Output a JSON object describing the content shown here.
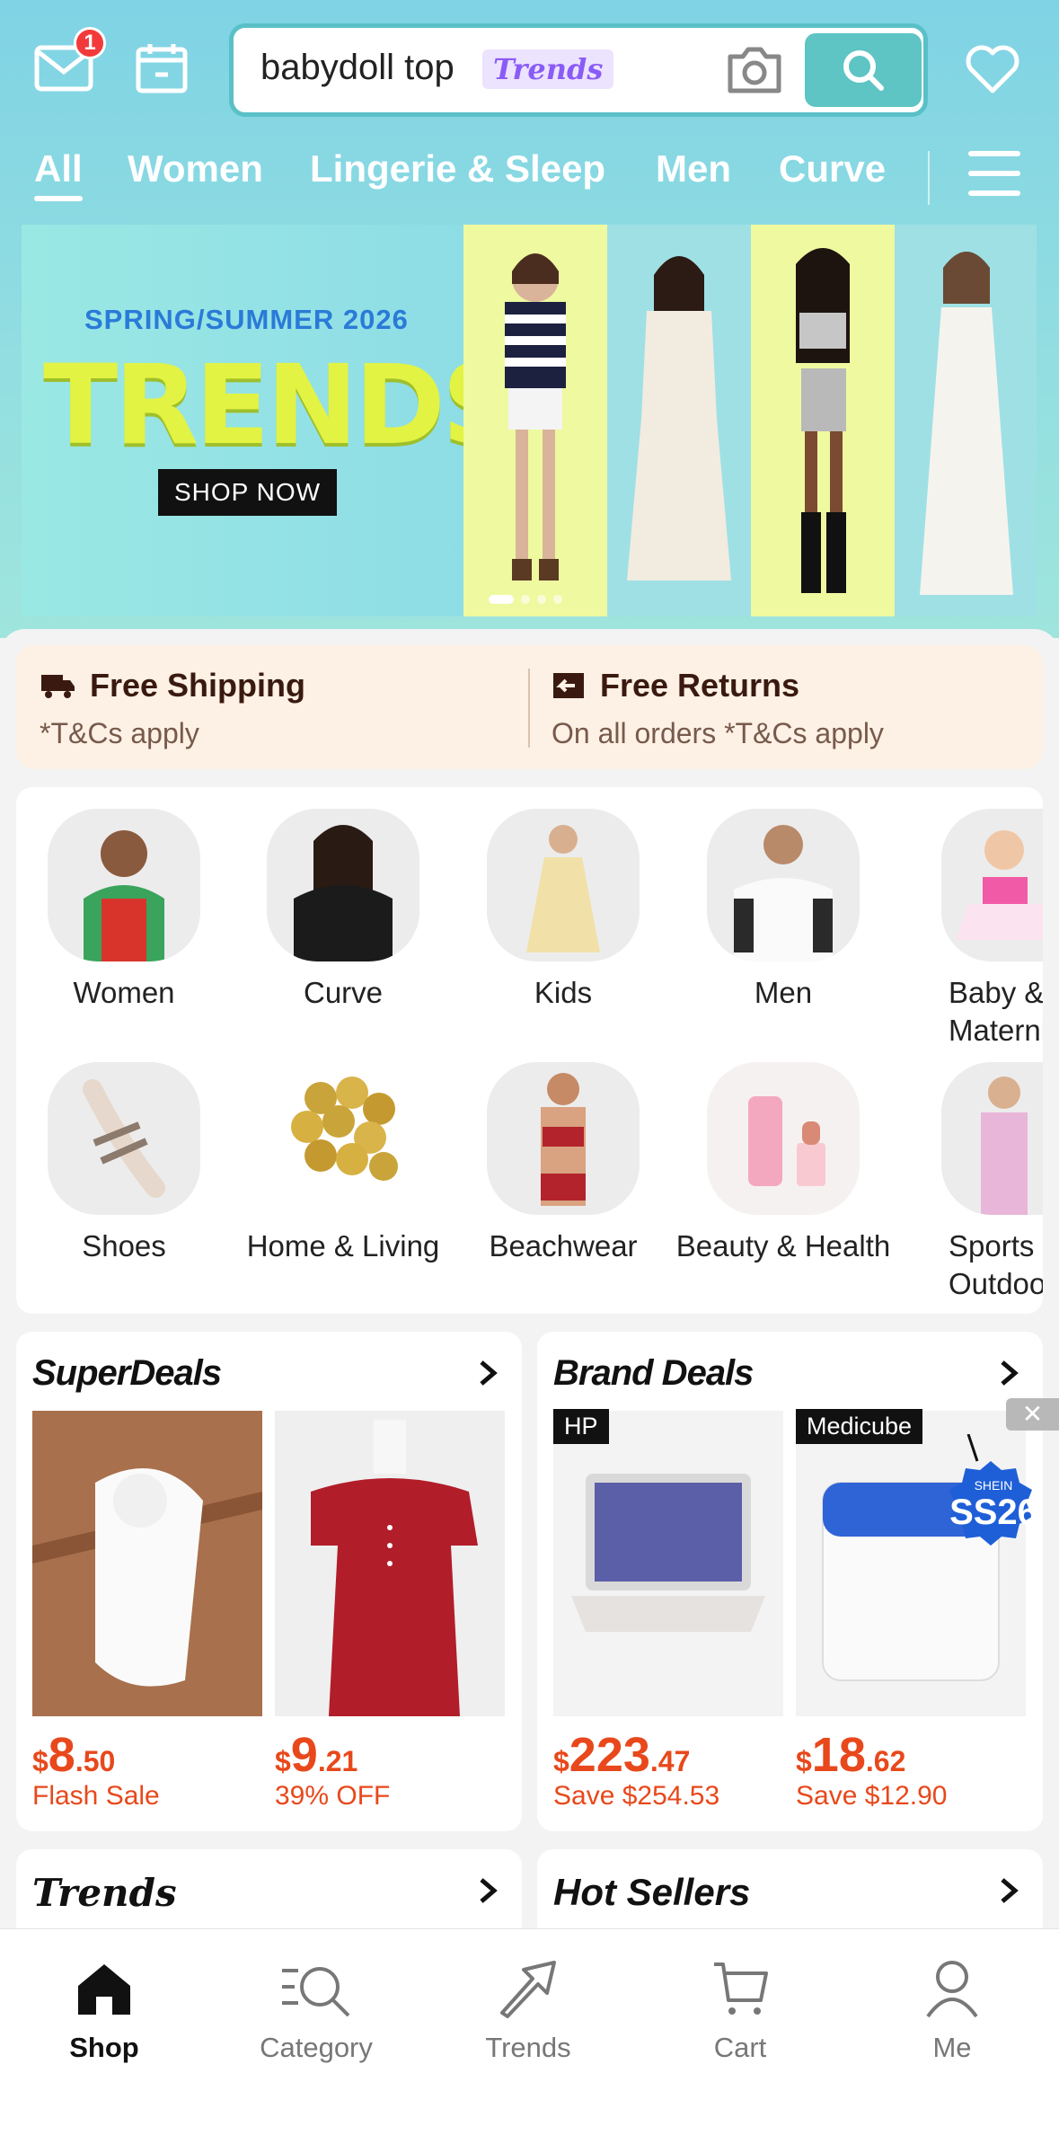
{
  "header": {
    "notification_count": "1",
    "search_query": "babydoll top",
    "search_tag": "Trends"
  },
  "tabs": [
    {
      "label": "All"
    },
    {
      "label": "Women"
    },
    {
      "label": "Lingerie & Sleep"
    },
    {
      "label": "Men"
    },
    {
      "label": "Curve"
    }
  ],
  "banner": {
    "subtitle": "SPRING/SUMMER 2026",
    "title": "TRENDS",
    "button": "SHOP NOW"
  },
  "promo": {
    "shipping_title": "Free Shipping",
    "shipping_sub": "*T&Cs apply",
    "returns_title": "Free Returns",
    "returns_sub": "On all orders *T&Cs apply"
  },
  "categories": [
    {
      "label": "Women"
    },
    {
      "label": "Curve"
    },
    {
      "label": "Kids"
    },
    {
      "label": "Men"
    },
    {
      "label": "Baby & Materni"
    },
    {
      "label": "Shoes"
    },
    {
      "label": "Home & Living"
    },
    {
      "label": "Beachwear"
    },
    {
      "label": "Beauty & Health"
    },
    {
      "label": "Sports & Outdoo"
    }
  ],
  "super_deals": {
    "title": "SuperDeals",
    "items": [
      {
        "currency": "$",
        "whole": "8",
        "cents": ".50",
        "sub": "Flash Sale"
      },
      {
        "currency": "$",
        "whole": "9",
        "cents": ".21",
        "sub": "39% OFF"
      }
    ]
  },
  "brand_deals": {
    "title": "Brand Deals",
    "items": [
      {
        "brand": "HP",
        "currency": "$",
        "whole": "223",
        "cents": ".47",
        "sub": "Save $254.53"
      },
      {
        "brand": "Medicube",
        "currency": "$",
        "whole": "18",
        "cents": ".62",
        "sub": "Save $12.90"
      }
    ]
  },
  "badge": {
    "text": "SS26",
    "brand": "SHEIN"
  },
  "sections": {
    "trends": "Trends",
    "hot_sellers": "Hot Sellers"
  },
  "nav": [
    {
      "label": "Shop"
    },
    {
      "label": "Category"
    },
    {
      "label": "Trends"
    },
    {
      "label": "Cart"
    },
    {
      "label": "Me"
    }
  ],
  "colors": {
    "accent": "#5ec4c4",
    "price": "#e8481b",
    "banner_title": "#e3f343"
  }
}
